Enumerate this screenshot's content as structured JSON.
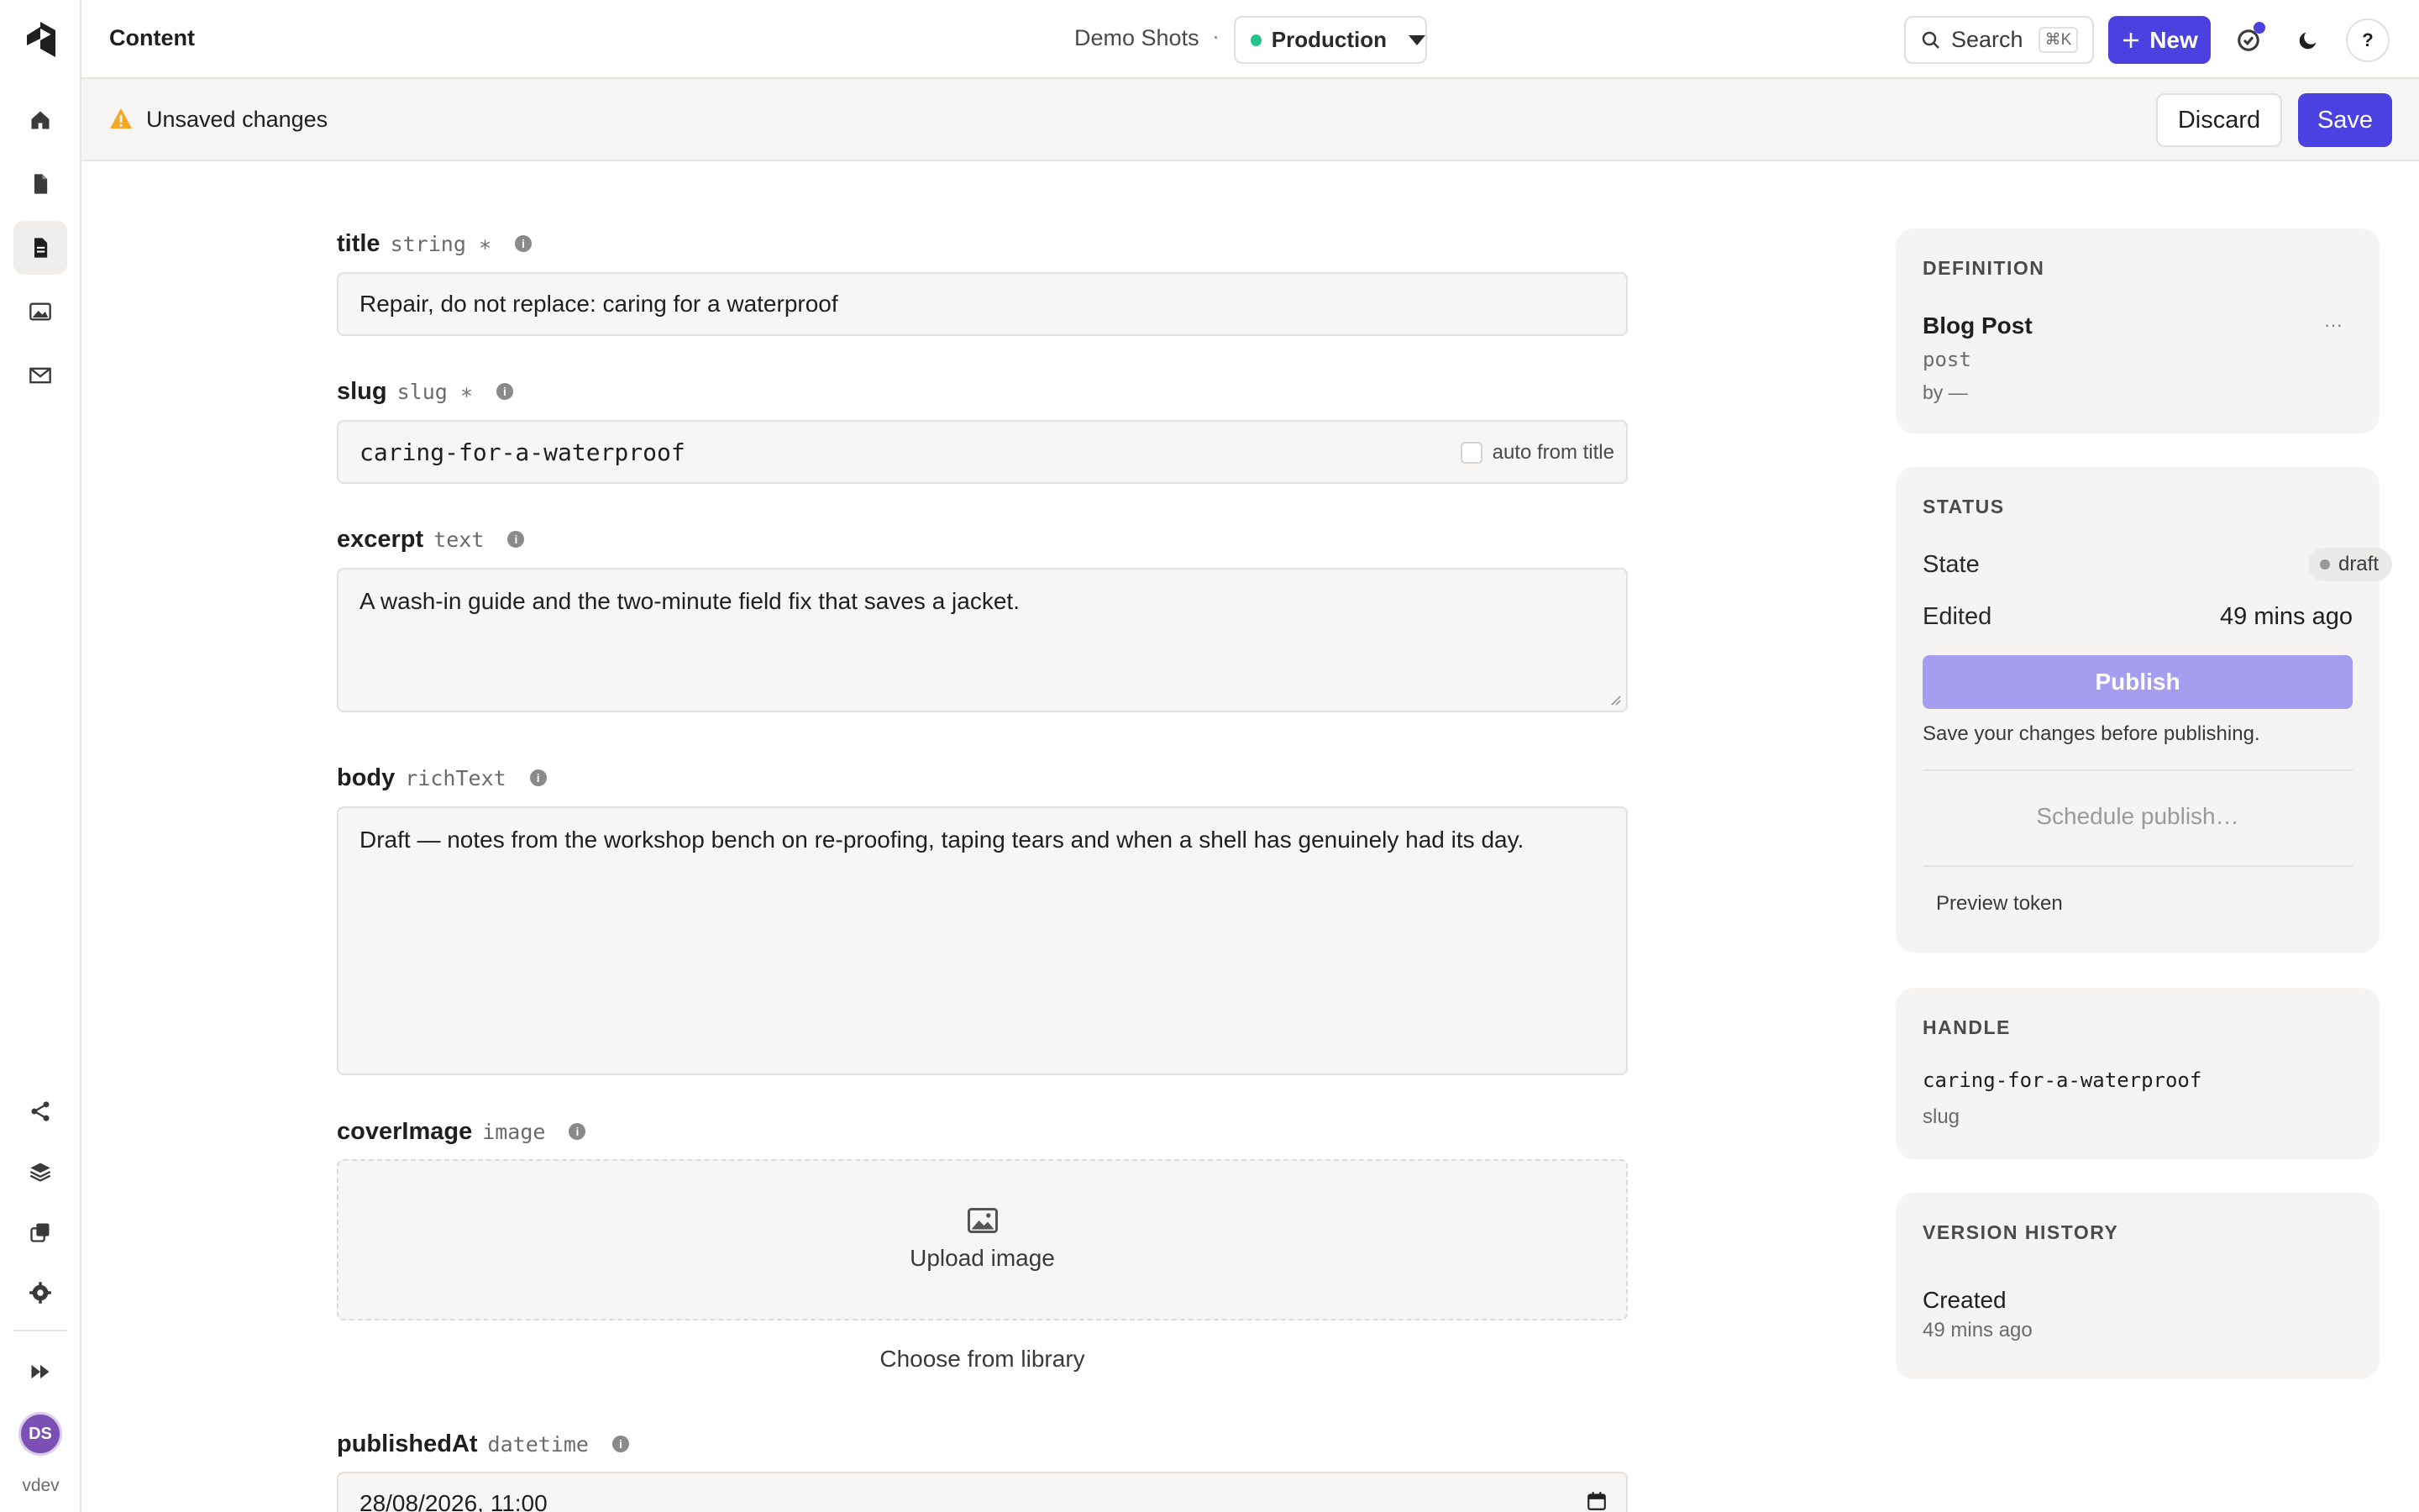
{
  "sidebar": {
    "nav": [
      {
        "name": "home-icon"
      },
      {
        "name": "document-icon"
      },
      {
        "name": "content-icon",
        "active": true
      },
      {
        "name": "image-icon"
      },
      {
        "name": "mail-icon"
      }
    ],
    "bottom_nav": [
      {
        "name": "share-icon"
      },
      {
        "name": "layers-icon"
      },
      {
        "name": "copy-icon"
      },
      {
        "name": "gear-icon"
      },
      {
        "name": "fast-forward-icon"
      }
    ],
    "avatar_initials": "DS",
    "env_label": "vdev"
  },
  "topbar": {
    "section": "Content",
    "project": "Demo Shots",
    "separator": "·",
    "environment": "Production",
    "search_label": "Search",
    "search_shortcut": "⌘K",
    "new_label": "New",
    "help_label": "?"
  },
  "unsaved": {
    "message": "Unsaved changes",
    "discard": "Discard",
    "save": "Save"
  },
  "fields": {
    "title": {
      "name": "title",
      "type": "string ∗",
      "value": "Repair, do not replace: caring for a waterproof"
    },
    "slug": {
      "name": "slug",
      "type": "slug ∗",
      "value": "caring-for-a-waterproof",
      "auto_label": "auto from title"
    },
    "excerpt": {
      "name": "excerpt",
      "type": "text",
      "value": "A wash-in guide and the two-minute field fix that saves a jacket."
    },
    "body": {
      "name": "body",
      "type": "richText",
      "value": "Draft — notes from the workshop bench on re-proofing, taping tears and when a shell has genuinely had its day."
    },
    "coverImage": {
      "name": "coverImage",
      "type": "image",
      "upload_label": "Upload image",
      "library_label": "Choose from library"
    },
    "publishedAt": {
      "name": "publishedAt",
      "type": "datetime",
      "value": "28/08/2026, 11:00"
    }
  },
  "info_glyph": "i",
  "definition": {
    "heading": "DEFINITION",
    "name": "Blog Post",
    "api_id": "post",
    "author": "by —",
    "menu": "···"
  },
  "status": {
    "heading": "STATUS",
    "state_label": "State",
    "state_value": "draft",
    "edited_label": "Edited",
    "edited_value": "49 mins ago",
    "publish_label": "Publish",
    "hint": "Save your changes before publishing.",
    "schedule_label": "Schedule publish…",
    "preview_label": "Preview token"
  },
  "handle": {
    "heading": "HANDLE",
    "value": "caring-for-a-waterproof",
    "kind": "slug"
  },
  "version_history": {
    "heading": "VERSION HISTORY",
    "event": "Created",
    "when": "49 mins ago"
  },
  "colors": {
    "accent": "#4a41e0",
    "accent_disabled": "#a49df0",
    "env_dot": "#22c48c",
    "warning": "#f5a623"
  }
}
